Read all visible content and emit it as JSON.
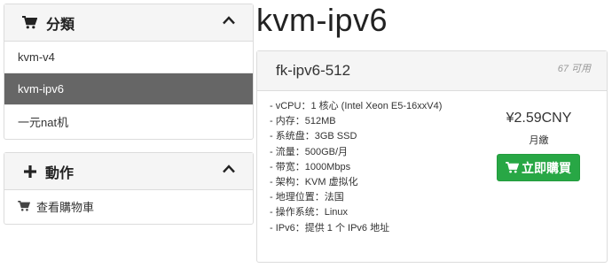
{
  "sidebar": {
    "categories": {
      "title": "分類",
      "items": [
        "kvm-v4",
        "kvm-ipv6",
        "一元nat机"
      ],
      "active_index": 1
    },
    "actions": {
      "title": "動作",
      "items": [
        "查看購物車"
      ]
    }
  },
  "main": {
    "page_title": "kvm-ipv6",
    "product": {
      "name": "fk-ipv6-512",
      "availability": "67 可用",
      "specs": [
        "- vCPU：1 核心 (Intel Xeon E5-16xxV4)",
        "- 内存：512MB",
        "- 系统盘：3GB SSD",
        "- 流量：500GB/月",
        "- 带宽：1000Mbps",
        "- 架构：KVM 虚拟化",
        "- 地理位置：法国",
        "- 操作系统：Linux",
        "- IPv6：提供 1 个 IPv6 地址"
      ],
      "price": "¥2.59CNY",
      "billing_cycle": "月繳",
      "buy_label": "立即購買"
    }
  },
  "colors": {
    "active_item": "#666666",
    "buy_button": "#28a745"
  }
}
